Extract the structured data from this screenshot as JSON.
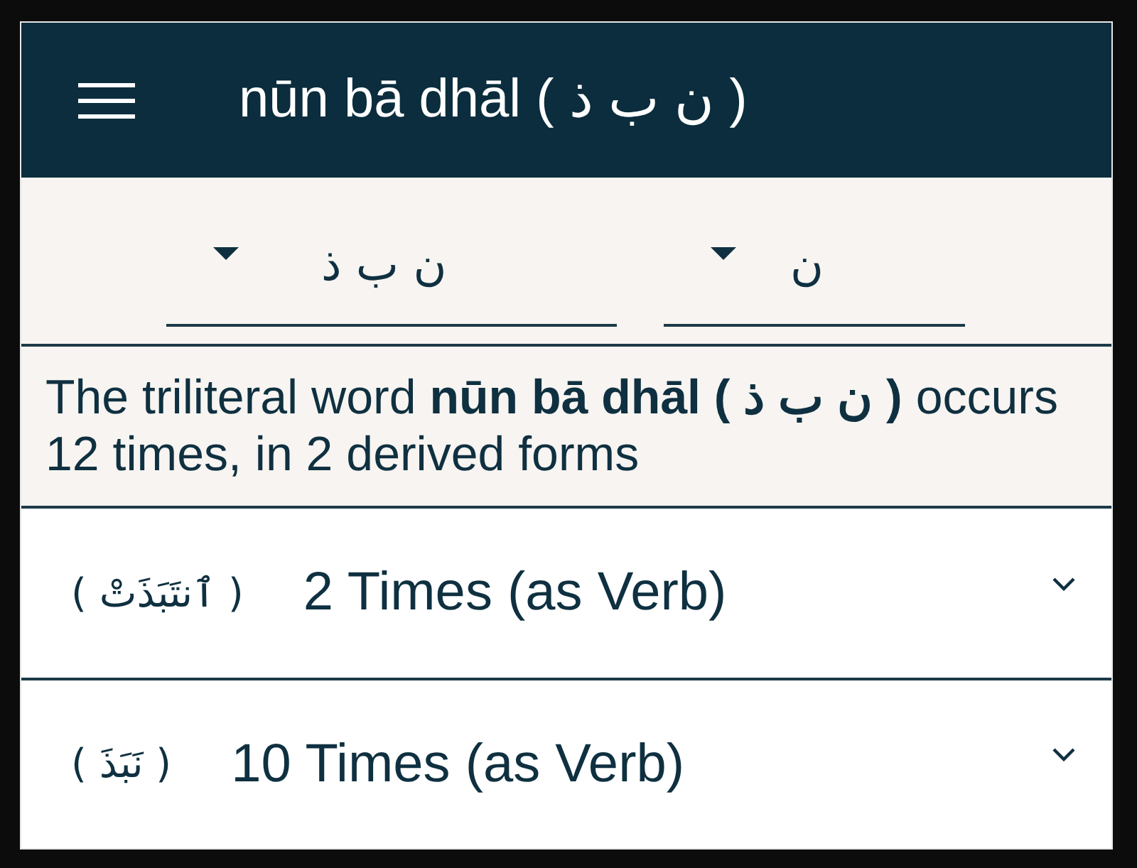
{
  "app_bar": {
    "title": "nūn bā dhāl ( ن ب ذ )"
  },
  "filters": [
    {
      "value": "ن"
    },
    {
      "value": "ن ب ذ"
    }
  ],
  "summary": "The triliteral word **nūn bā dhāl ( ن ب ذ )** occurs 12 times, in 2 derived forms",
  "forms": [
    {
      "arabic": "( ٱنتَبَذَتْ )",
      "label": "2 Times (as Verb)",
      "expanded": false
    },
    {
      "arabic": "( نَبَذَ )",
      "label": "10 Times (as Verb)",
      "expanded": false
    }
  ]
}
